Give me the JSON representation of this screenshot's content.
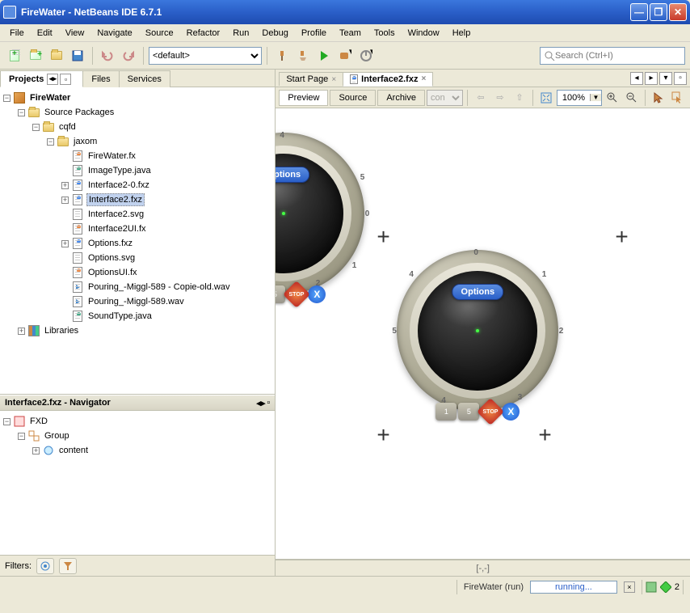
{
  "window": {
    "title": "FireWater - NetBeans IDE 6.7.1"
  },
  "menu": [
    "File",
    "Edit",
    "View",
    "Navigate",
    "Source",
    "Refactor",
    "Run",
    "Debug",
    "Profile",
    "Team",
    "Tools",
    "Window",
    "Help"
  ],
  "toolbar": {
    "config_select": "<default>",
    "search_placeholder": "Search (Ctrl+I)"
  },
  "left_tabs": [
    {
      "label": "Projects",
      "active": true
    },
    {
      "label": "Files",
      "active": false
    },
    {
      "label": "Services",
      "active": false
    }
  ],
  "project_tree": {
    "root": "FireWater",
    "n0": "Source Packages",
    "n1": "cqfd",
    "n2": "jaxom",
    "files": [
      {
        "name": "FireWater.fx",
        "type": "fx"
      },
      {
        "name": "ImageType.java",
        "type": "java"
      },
      {
        "name": "Interface2-0.fxz",
        "type": "fxz",
        "exp": true
      },
      {
        "name": "Interface2.fxz",
        "type": "fxz",
        "exp": true,
        "selected": true
      },
      {
        "name": "Interface2.svg",
        "type": "file"
      },
      {
        "name": "Interface2UI.fx",
        "type": "fx"
      },
      {
        "name": "Options.fxz",
        "type": "fxz",
        "exp": true
      },
      {
        "name": "Options.svg",
        "type": "file"
      },
      {
        "name": "OptionsUI.fx",
        "type": "fx"
      },
      {
        "name": "Pouring_-Miggl-589 - Copie-old.wav",
        "type": "wav"
      },
      {
        "name": "Pouring_-Miggl-589.wav",
        "type": "wav"
      },
      {
        "name": "SoundType.java",
        "type": "java"
      }
    ],
    "libraries": "Libraries"
  },
  "navigator": {
    "title": "Interface2.fxz - Navigator",
    "root": "FXD",
    "group": "Group",
    "content": "content",
    "filters_label": "Filters:"
  },
  "editor_tabs": [
    {
      "label": "Start Page",
      "active": false
    },
    {
      "label": "Interface2.fxz",
      "active": true
    }
  ],
  "editor_subbar": {
    "tabs": [
      "Preview",
      "Source",
      "Archive"
    ],
    "active_tab": "Preview",
    "select": "con",
    "zoom": "100%"
  },
  "dial": {
    "options_label": "Options",
    "btn1": "1",
    "btn5": "5",
    "stop": "STOP",
    "x": "X",
    "nums": {
      "n0": "0",
      "n1": "1",
      "n2": "2",
      "n3": "3",
      "n4": "4",
      "n5": "5"
    }
  },
  "canvas_status": "[-,-]",
  "statusbar": {
    "task": "FireWater (run)",
    "state": "running...",
    "count": "2"
  }
}
